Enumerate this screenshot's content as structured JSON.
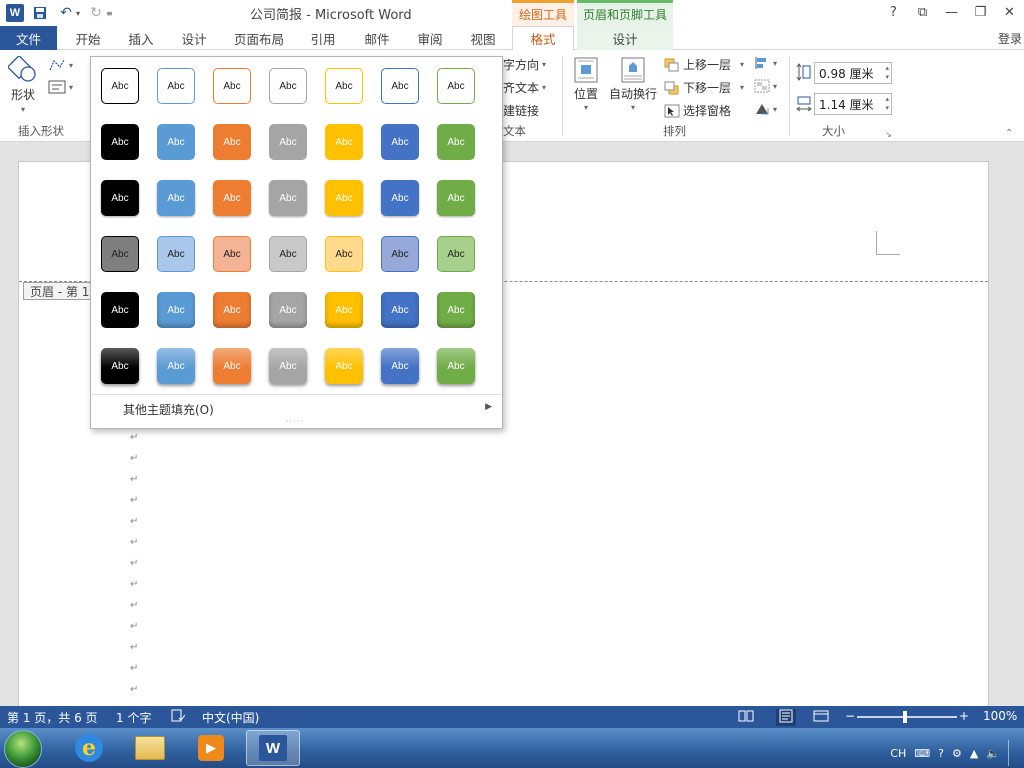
{
  "window": {
    "title": "公司简报 - Microsoft Word",
    "app_icon_letter": "W",
    "ctx_drawing_tools": "绘图工具",
    "ctx_header_footer_tools": "页眉和页脚工具",
    "controls": {
      "help": "?",
      "ribbon_display": "⧉",
      "minimize": "—",
      "restore": "❐",
      "close": "✕"
    }
  },
  "tabs": [
    {
      "label": "文件"
    },
    {
      "label": "开始"
    },
    {
      "label": "插入"
    },
    {
      "label": "设计"
    },
    {
      "label": "页面布局"
    },
    {
      "label": "引用"
    },
    {
      "label": "邮件"
    },
    {
      "label": "审阅"
    },
    {
      "label": "视图"
    },
    {
      "label": "格式"
    },
    {
      "label": "设计"
    }
  ],
  "login_label": "登录",
  "ribbon": {
    "shape_label": "形状",
    "insert_shapes_group": "插入形状",
    "text_direction": "文字方向",
    "align_text": "对齐文本",
    "create_link": "创建链接",
    "text_group_partial": "文本",
    "position": "位置",
    "wrap_text": "自动换行",
    "bring_forward": "上移一层",
    "send_backward": "下移一层",
    "selection_pane": "选择窗格",
    "arrange_group": "排列",
    "height_value": "0.98 厘米",
    "width_value": "1.14 厘米",
    "size_group": "大小"
  },
  "gallery": {
    "swatch_label": "Abc",
    "colors": [
      "#000000",
      "#5b9bd5",
      "#ed7d31",
      "#a5a5a5",
      "#ffc000",
      "#4472c4",
      "#70ad47"
    ],
    "light_colors": [
      "#7f7f7f",
      "#a9c7ea",
      "#f5b395",
      "#c9c9c9",
      "#ffd98c",
      "#97a9d8",
      "#a8d08d"
    ],
    "more_fills": "其他主题填充(O)"
  },
  "document": {
    "header_tag": "页眉 - 第 1 节 -",
    "paragraph_mark": "↵"
  },
  "status": {
    "page": "第 1 页，共 6 页",
    "words": "1 个字",
    "language": "中文(中国)",
    "zoom": "100%"
  },
  "taskbar": {
    "ime": "CH"
  }
}
